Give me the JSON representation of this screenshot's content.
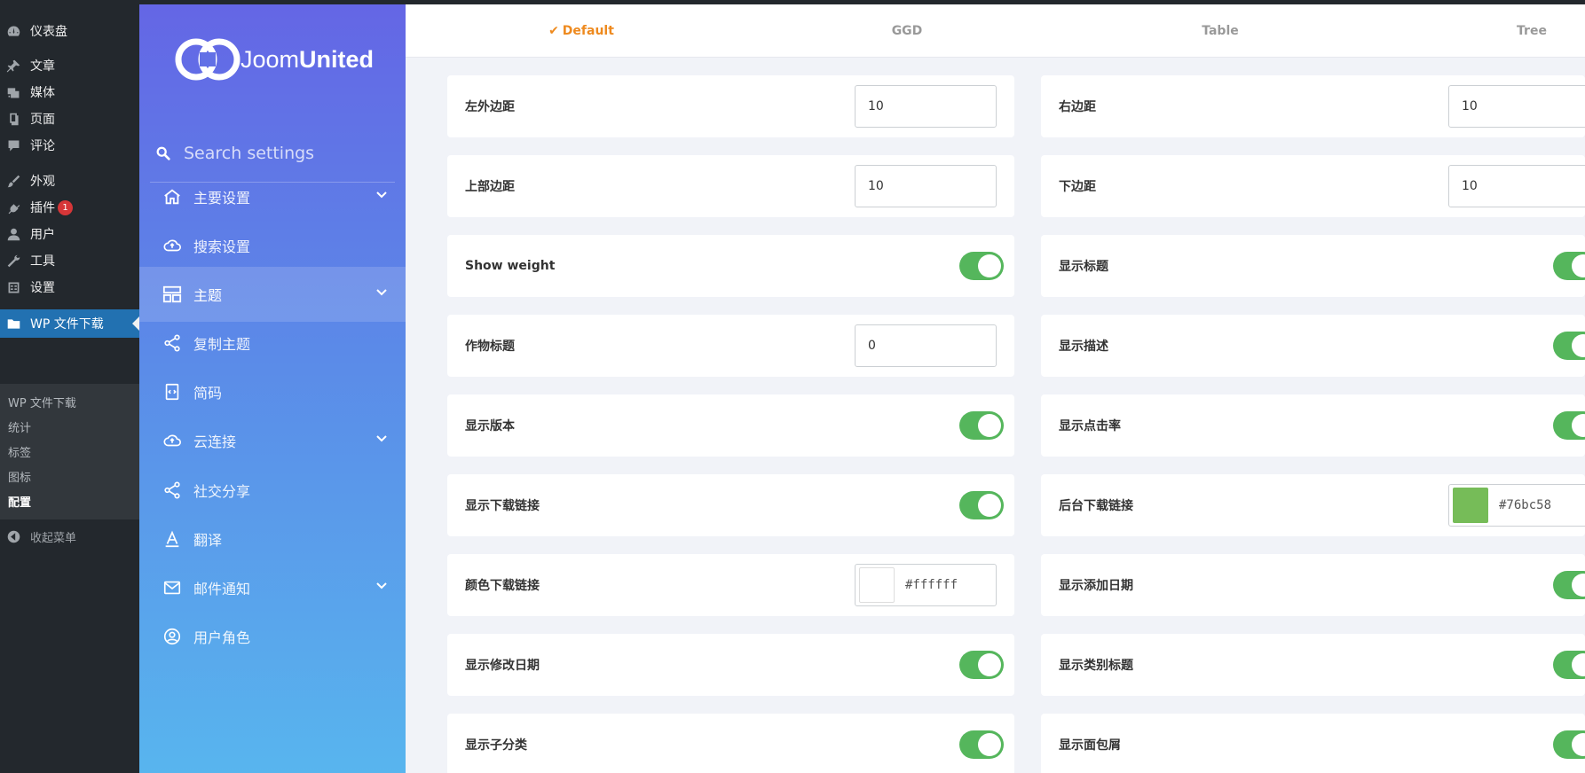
{
  "wp_menu": {
    "items": [
      {
        "label": "仪表盘",
        "icon": "dashboard-icon"
      },
      {
        "label": "文章",
        "icon": "pin-icon"
      },
      {
        "label": "媒体",
        "icon": "media-icon"
      },
      {
        "label": "页面",
        "icon": "page-icon"
      },
      {
        "label": "评论",
        "icon": "comment-icon"
      },
      {
        "label": "外观",
        "icon": "brush-icon"
      },
      {
        "label": "插件",
        "icon": "plugin-icon",
        "badge": "1"
      },
      {
        "label": "用户",
        "icon": "user-icon"
      },
      {
        "label": "工具",
        "icon": "wrench-icon"
      },
      {
        "label": "设置",
        "icon": "settings-icon"
      },
      {
        "label": "WP 文件下载",
        "icon": "folder-icon"
      }
    ],
    "submenu": [
      "WP 文件下载",
      "统计",
      "标签",
      "图标",
      "配置"
    ],
    "collapse": "收起菜单"
  },
  "plugin_sidebar": {
    "logo_text_light": "Joom",
    "logo_text_bold": "United",
    "search_placeholder": "Search settings",
    "items": [
      {
        "label": "主要设置",
        "icon": "home-icon",
        "chevron": true
      },
      {
        "label": "搜索设置",
        "icon": "cloud-upload-icon",
        "chevron": false
      },
      {
        "label": "主题",
        "icon": "layout-icon",
        "chevron": true,
        "active": true
      },
      {
        "label": "复制主题",
        "icon": "share-icon",
        "chevron": false
      },
      {
        "label": "简码",
        "icon": "code-icon",
        "chevron": false
      },
      {
        "label": "云连接",
        "icon": "cloud-icon",
        "chevron": true
      },
      {
        "label": "社交分享",
        "icon": "social-share-icon",
        "chevron": false
      },
      {
        "label": "翻译",
        "icon": "translate-icon",
        "chevron": false
      },
      {
        "label": "邮件通知",
        "icon": "mail-icon",
        "chevron": true
      },
      {
        "label": "用户角色",
        "icon": "user-circle-icon",
        "chevron": false
      }
    ]
  },
  "theme_tabs": [
    {
      "label": "Default",
      "active": true,
      "check": "✔"
    },
    {
      "label": "GGD"
    },
    {
      "label": "Table"
    },
    {
      "label": "Tree"
    }
  ],
  "settings": {
    "left": [
      {
        "label": "左外边距",
        "type": "number",
        "value": "10"
      },
      {
        "label": "上部边距",
        "type": "number",
        "value": "10"
      },
      {
        "label": "Show weight",
        "type": "toggle",
        "on": true
      },
      {
        "label": "作物标题",
        "type": "number",
        "value": "0"
      },
      {
        "label": "显示版本",
        "type": "toggle",
        "on": true
      },
      {
        "label": "显示下载链接",
        "type": "toggle",
        "on": true
      },
      {
        "label": "颜色下载链接",
        "type": "color",
        "value": "#ffffff",
        "swatch": "#ffffff"
      },
      {
        "label": "显示修改日期",
        "type": "toggle",
        "on": true
      },
      {
        "label": "显示子分类",
        "type": "toggle",
        "on": true
      }
    ],
    "right": [
      {
        "label": "右边距",
        "type": "number",
        "value": "10"
      },
      {
        "label": "下边距",
        "type": "number",
        "value": "10"
      },
      {
        "label": "显示标题",
        "type": "toggle",
        "on": true
      },
      {
        "label": "显示描述",
        "type": "toggle",
        "on": true
      },
      {
        "label": "显示点击率",
        "type": "toggle",
        "on": true
      },
      {
        "label": "后台下载链接",
        "type": "color",
        "value": "#76bc58",
        "swatch": "#76bc58"
      },
      {
        "label": "显示添加日期",
        "type": "toggle",
        "on": true
      },
      {
        "label": "显示类别标题",
        "type": "toggle",
        "on": true
      },
      {
        "label": "显示面包屑",
        "type": "toggle",
        "on": true
      }
    ]
  },
  "colors": {
    "toggle_on": "#55b65c",
    "accent_tab": "#ee8a1f",
    "wp_active": "#2271b1"
  }
}
